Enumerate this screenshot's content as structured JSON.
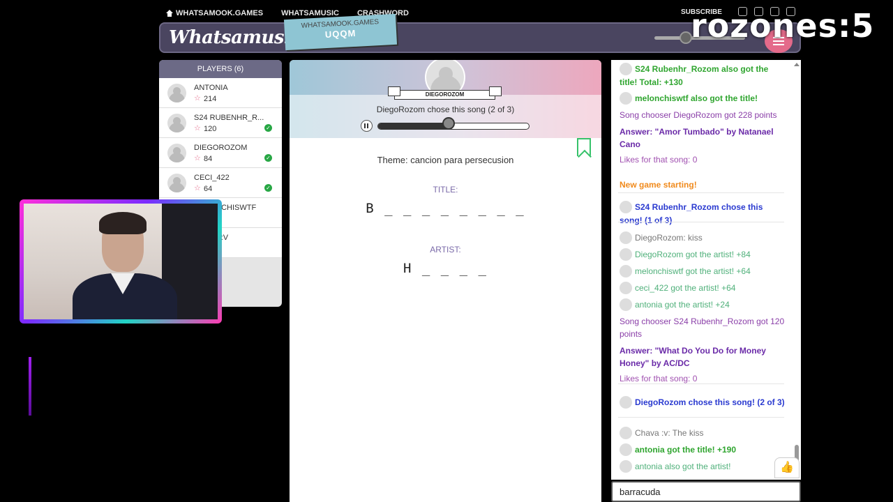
{
  "nav": {
    "links": [
      "WHATSAMOOK.GAMES",
      "WHATSAMUSIC",
      "CRASHWORD"
    ],
    "subscribe": "SUBSCRIBE"
  },
  "header": {
    "logo": "Whatsamusic",
    "room_site": "WHATSAMOOK.GAMES",
    "room_code": "UQQM"
  },
  "overlay": "rozones:5",
  "players": {
    "heading": "PLAYERS (6)",
    "list": [
      {
        "name": "ANTONIA",
        "score": "214",
        "guessed": false
      },
      {
        "name": "S24 RUBENHR_R...",
        "score": "120",
        "guessed": true
      },
      {
        "name": "DIEGOROZOM",
        "score": "84",
        "guessed": true
      },
      {
        "name": "CECI_422",
        "score": "64",
        "guessed": true
      },
      {
        "name": "MELONCHISWTF",
        "score": "",
        "guessed": false
      },
      {
        "name": "CHAVA :V",
        "score": "",
        "guessed": false
      }
    ]
  },
  "game": {
    "chooser_name": "DIEGOROZOM",
    "chose_text": "DiegoRozom chose this song (2 of 3)",
    "progress": 0.47,
    "theme": "Theme: cancion para persecusion",
    "title_label": "TITLE:",
    "title_hint": "B _ _ _ _ _ _ _ _",
    "artist_label": "ARTIST:",
    "artist_hint": "H _ _ _ _"
  },
  "chat": {
    "messages": [
      {
        "text": "S24 Rubenhr_Rozom also got the title! Total: +130",
        "style": "green-b",
        "avatar": true
      },
      {
        "text": "melonchiswtf also got the title!",
        "style": "green-b",
        "avatar": true
      },
      {
        "text": "Song chooser DiegoRozom got 228 points",
        "style": "purple",
        "avatar": false
      },
      {
        "text": "Answer: \"Amor Tumbado\" by Natanael Cano",
        "style": "purple-b",
        "avatar": false
      },
      {
        "text": "Likes for that song: 0",
        "style": "pink",
        "avatar": false
      },
      {
        "text": "New game starting!",
        "style": "orange-b",
        "avatar": false
      },
      {
        "text": "S24 Rubenhr_Rozom chose this song! (1 of 3)",
        "style": "blue-b",
        "avatar": true
      },
      {
        "text": "DiegoRozom: kiss",
        "style": "gray",
        "avatar": true
      },
      {
        "text": "DiegoRozom got the artist! +84",
        "style": "lgreen",
        "avatar": true
      },
      {
        "text": "melonchiswtf got the artist! +64",
        "style": "lgreen",
        "avatar": true
      },
      {
        "text": "ceci_422 got the artist! +64",
        "style": "lgreen",
        "avatar": true
      },
      {
        "text": "antonia got the artist! +24",
        "style": "lgreen",
        "avatar": true
      },
      {
        "text": "Song chooser S24 Rubenhr_Rozom got 120 points",
        "style": "purple",
        "avatar": false
      },
      {
        "text": "Answer: \"What Do You Do for Money Honey\" by AC/DC",
        "style": "purple-b",
        "avatar": false
      },
      {
        "text": "Likes for that song: 0",
        "style": "pink",
        "avatar": false
      },
      {
        "text": "DiegoRozom chose this song! (2 of 3)",
        "style": "blue-b",
        "avatar": true
      },
      {
        "text": "Chava :v: The kiss",
        "style": "gray",
        "avatar": true
      },
      {
        "text": "antonia got the title! +190",
        "style": "green-b",
        "avatar": true
      },
      {
        "text": "antonia also got the artist!",
        "style": "lgreen",
        "avatar": true
      }
    ],
    "input_value": "barracuda"
  }
}
